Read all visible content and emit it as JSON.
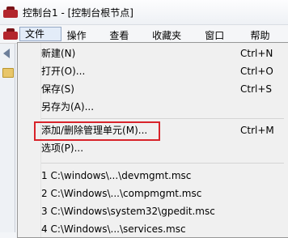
{
  "window": {
    "title": "控制台1 - [控制台根节点]"
  },
  "menubar": {
    "items": [
      "文件(F)",
      "操作(A)",
      "查看(V)",
      "收藏夹(O)",
      "窗口(W)",
      "帮助(H)"
    ]
  },
  "file_menu": {
    "items": [
      {
        "label": "新建(N)",
        "shortcut": "Ctrl+N"
      },
      {
        "label": "打开(O)...",
        "shortcut": "Ctrl+O"
      },
      {
        "label": "保存(S)",
        "shortcut": "Ctrl+S"
      },
      {
        "label": "另存为(A)...",
        "shortcut": ""
      },
      {
        "label": "添加/删除管理单元(M)...",
        "shortcut": "Ctrl+M"
      },
      {
        "label": "选项(P)...",
        "shortcut": ""
      }
    ],
    "recent": [
      "1 C:\\windows\\...\\devmgmt.msc",
      "2 C:\\Windows\\...\\compmgmt.msc",
      "3 C:\\Windows\\system32\\gpedit.msc",
      "4 C:\\Windows\\...\\services.msc"
    ]
  },
  "colors": {
    "highlight": "#d8232a",
    "menu_bg": "#f0f0f0"
  }
}
